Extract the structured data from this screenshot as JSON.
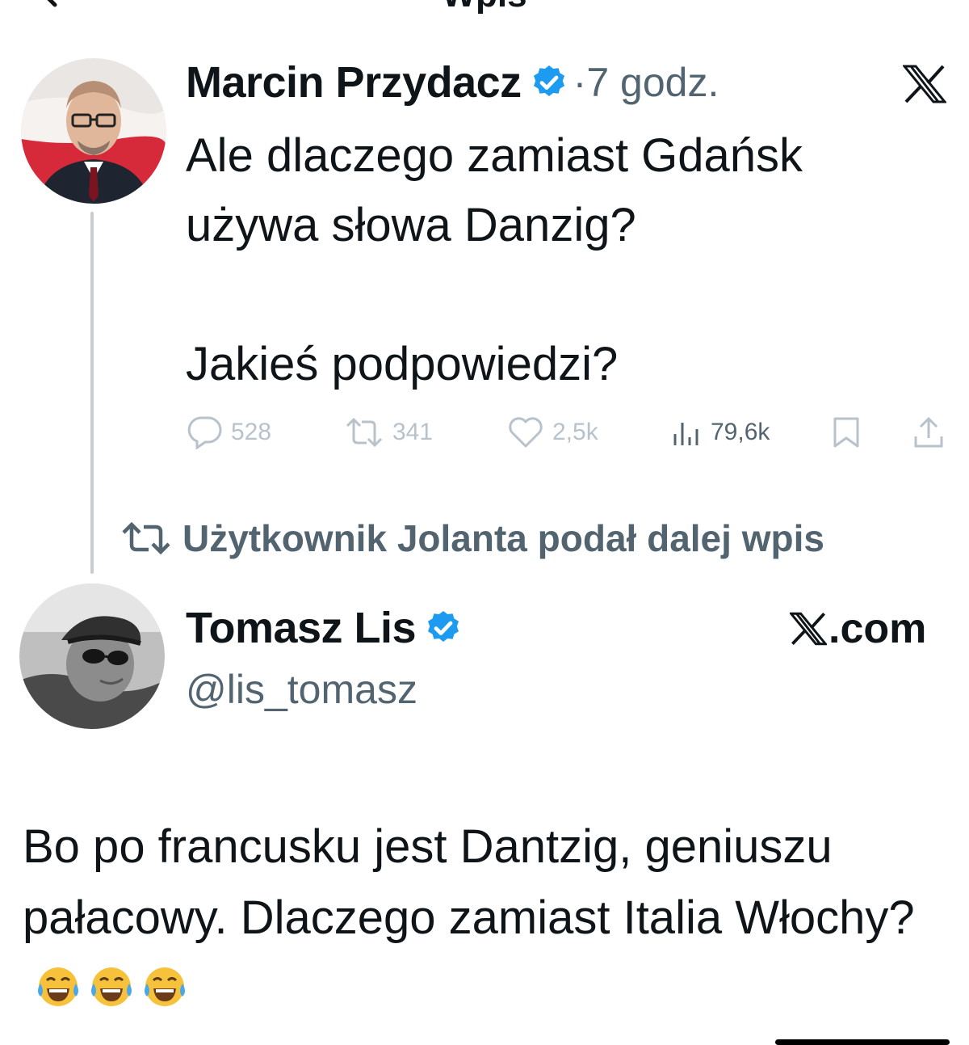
{
  "header": {
    "title": "Wpis",
    "back_icon": "back-arrow-icon"
  },
  "tweet": {
    "author_name": "Marcin Przydacz",
    "verified_icon": "verified-badge-icon",
    "time": "·7 godz.",
    "x_logo": "x-logo-icon",
    "lines": [
      "Ale dlaczego zamiast Gdańsk",
      "używa słowa Danzig?",
      "Jakieś podpowiedzi?"
    ],
    "actions": {
      "replies": "528",
      "reposts": "341",
      "likes": "2,5k",
      "views": "79,6k"
    }
  },
  "retweet_notice": {
    "icon": "retweet-icon",
    "text": "Użytkownik Jolanta podał dalej wpis"
  },
  "reply": {
    "author_name": "Tomasz Lis",
    "handle": "@lis_tomasz",
    "source_label": ".com",
    "text": "Bo po francusku jest Dantzig, geniuszu pałacowy. Dlaczego zamiast Italia Włochy?",
    "emojis": [
      "tears-of-joy-emoji",
      "tears-of-joy-emoji",
      "tears-of-joy-emoji"
    ]
  },
  "colors": {
    "text": "#0f1419",
    "secondary": "#536471",
    "faded": "#b8c2cb",
    "verified": "#1d9bf0",
    "thread_line": "#c8cdd2"
  }
}
